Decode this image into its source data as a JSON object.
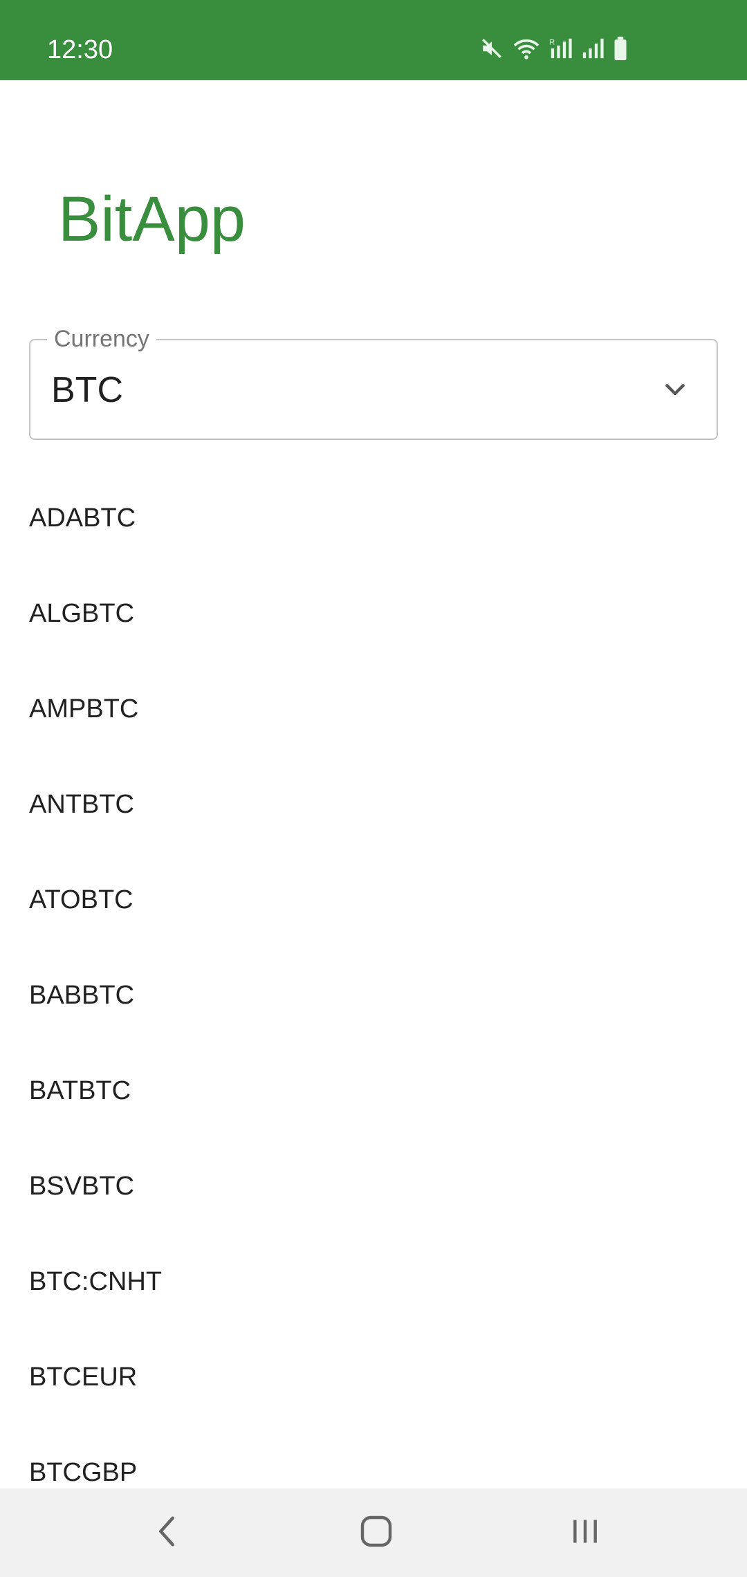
{
  "status_bar": {
    "time": "12:30",
    "icons": [
      "mute-icon",
      "wifi-icon",
      "signal-roaming-icon",
      "signal-icon",
      "battery-icon"
    ],
    "background": "#388e3c"
  },
  "app": {
    "title": "BitApp",
    "accent": "#388e3c"
  },
  "currency_select": {
    "label": "Currency",
    "value": "BTC",
    "icon": "chevron-down-icon"
  },
  "pairs": [
    {
      "label": "ADABTC"
    },
    {
      "label": "ALGBTC"
    },
    {
      "label": "AMPBTC"
    },
    {
      "label": "ANTBTC"
    },
    {
      "label": "ATOBTC"
    },
    {
      "label": "BABBTC"
    },
    {
      "label": "BATBTC"
    },
    {
      "label": "BSVBTC"
    },
    {
      "label": "BTC:CNHT"
    },
    {
      "label": "BTCEUR"
    },
    {
      "label": "BTCGBP"
    }
  ],
  "nav_bar": {
    "buttons": [
      "back-icon",
      "home-icon",
      "recents-icon"
    ]
  }
}
